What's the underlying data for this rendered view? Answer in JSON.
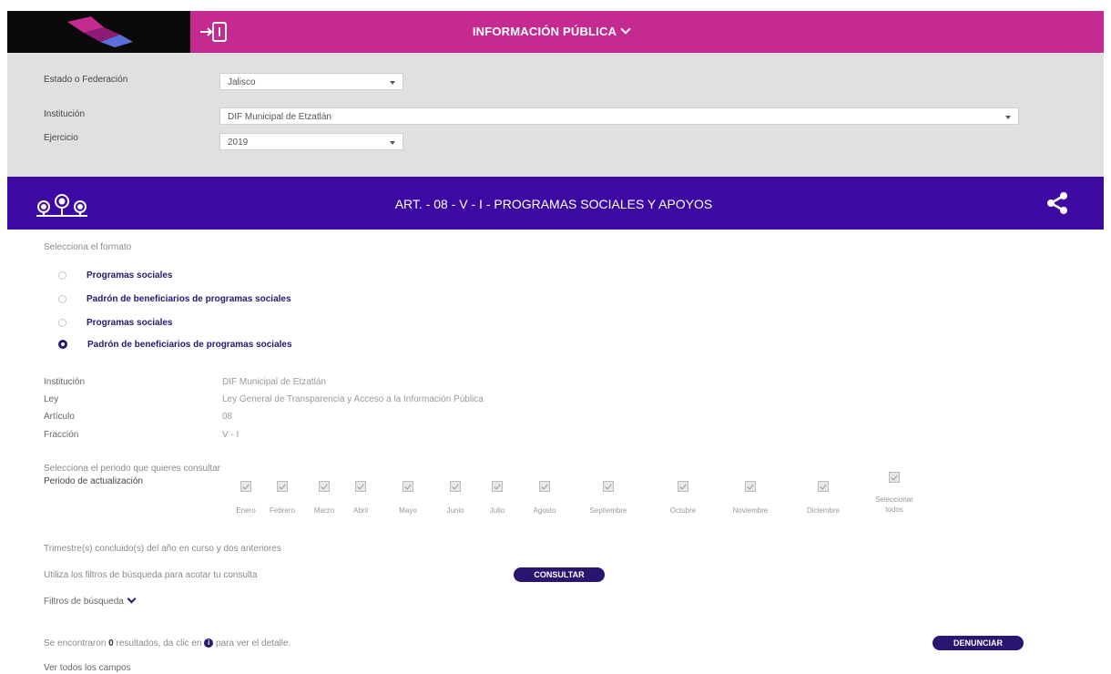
{
  "header": {
    "title": "INFORMACIÓN PÚBLICA",
    "logo_icon": "mx-logo-icon",
    "login_icon": "login-icon"
  },
  "filters": {
    "estado_label": "Estado o Federación",
    "estado_value": "Jalisco",
    "institucion_label": "Institución",
    "institucion_value": "DIF Municipal de Etzatlán",
    "ejercicio_label": "Ejercicio",
    "ejercicio_value": "2019"
  },
  "article": {
    "title": "ART. - 08 - V - I - PROGRAMAS SOCIALES Y APOYOS",
    "share_icon": "share-icon"
  },
  "formats": {
    "prompt": "Selecciona el formato",
    "options": [
      {
        "label": "Programas sociales",
        "checked": false
      },
      {
        "label": "Padrón de beneficiarios de programas sociales",
        "checked": false
      },
      {
        "label": "Programas sociales",
        "checked": false
      },
      {
        "label": "Padrón de beneficiarios de programas sociales",
        "checked": true
      }
    ]
  },
  "meta": {
    "institucion_label": "Institución",
    "institucion_value": "DIF Municipal de Etzatlán",
    "ley_label": "Ley",
    "ley_value": "Ley General de Transparencia y Acceso a la Información Pública",
    "articulo_label": "Artículo",
    "articulo_value": "08",
    "fraccion_label": "Fracción",
    "fraccion_value": "V - I"
  },
  "period": {
    "prompt": "Selecciona el periodo que quieres consultar",
    "label": "Periodo de actualización",
    "months": [
      "Enero",
      "Febrero",
      "Marzo",
      "Abril",
      "Mayo",
      "Junio",
      "Julio",
      "Agosto",
      "Septiembre",
      "Octubre",
      "Noviembre",
      "Diciembre"
    ],
    "select_all_1": "Seleccionar",
    "select_all_2": "todos",
    "note": "Trimestre(s) concluido(s) del año en curso y dos anteriores"
  },
  "search": {
    "hint": "Utiliza los filtros de búsqueda para acotar tu consulta",
    "consultar": "CONSULTAR",
    "filtros": "Filtros de búsqueda"
  },
  "results": {
    "prefix": "Se encontraron",
    "count": "0",
    "middle": "resultados, da clic en",
    "info": "i",
    "suffix": "para ver el detalle.",
    "denunciar": "DENUNCIAR",
    "ver_todos": "Ver todos los campos"
  }
}
